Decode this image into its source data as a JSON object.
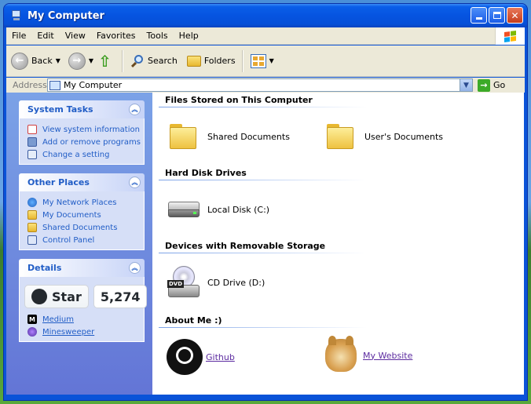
{
  "window": {
    "title": "My Computer"
  },
  "menu": {
    "items": [
      "File",
      "Edit",
      "View",
      "Favorites",
      "Tools",
      "Help"
    ]
  },
  "toolbar": {
    "back": "Back",
    "search": "Search",
    "folders": "Folders"
  },
  "address": {
    "label": "Address",
    "value": "My Computer",
    "go": "Go"
  },
  "tasks": {
    "system": {
      "title": "System Tasks",
      "items": [
        "View system information",
        "Add or remove programs",
        "Change a setting"
      ]
    },
    "other": {
      "title": "Other Places",
      "items": [
        "My Network Places",
        "My Documents",
        "Shared Documents",
        "Control Panel"
      ]
    },
    "details": {
      "title": "Details",
      "star_label": "Star",
      "star_count": "5,274",
      "links": [
        "Medium",
        "Minesweeper"
      ]
    }
  },
  "main": {
    "files_title": "Files Stored on This Computer",
    "files": [
      "Shared Documents",
      "User's Documents"
    ],
    "hdd_title": "Hard Disk Drives",
    "hdd": [
      "Local Disk (C:)"
    ],
    "removable_title": "Devices with Removable Storage",
    "removable": [
      "CD Drive (D:)"
    ],
    "dvd_label": "DVD",
    "about_title": "About Me :)",
    "about": [
      "Github",
      "My Website"
    ]
  }
}
